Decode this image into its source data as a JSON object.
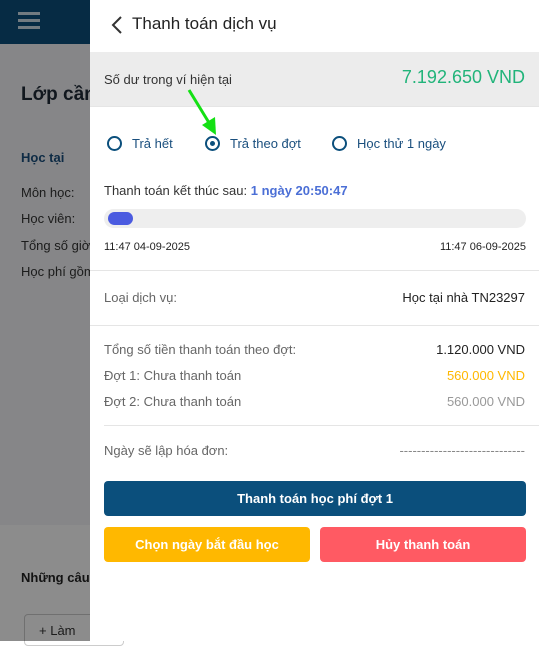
{
  "background": {
    "title": "Lớp cần",
    "tab": "Học tại",
    "rows": [
      "Môn học:",
      "Học viên:",
      "Tổng số giờ",
      "Học phí gồm"
    ],
    "section": "Những câu",
    "add_button": "Làm"
  },
  "panel": {
    "title": "Thanh toán dịch vụ",
    "balance_label": "Số dư trong ví hiện tại",
    "balance_value": "7.192.650 VND",
    "options": [
      {
        "label": "Trả hết",
        "checked": false
      },
      {
        "label": "Trả theo đợt",
        "checked": true
      },
      {
        "label": "Học thử 1 ngày",
        "checked": false
      }
    ],
    "countdown_label": "Thanh toán kết thúc sau:",
    "countdown_value": "1 ngày 20:50:47",
    "progress_fraction": 0.06,
    "start_time": "11:47 04-09-2025",
    "end_time": "11:47 06-09-2025",
    "service_label": "Loại dịch vụ:",
    "service_value": "Học tại nhà TN23297",
    "total_label": "Tổng số tiền thanh toán theo đợt:",
    "total_value": "1.120.000 VND",
    "phase1_label": "Đợt 1: Chưa thanh toán",
    "phase1_value": "560.000 VND",
    "phase2_label": "Đợt 2: Chưa thanh toán",
    "phase2_value": "560.000 VND",
    "invoice_label": "Ngày sẽ lập hóa đơn:",
    "invoice_value": "-----------------------------",
    "pay_button": "Thanh toán học phí đợt 1",
    "start_button": "Chọn ngày bắt đầu học",
    "cancel_button": "Hủy thanh toán"
  },
  "colors": {
    "primary": "#0b4f7c",
    "balance": "#21b47a",
    "phase1": "#ffb800",
    "phase2": "#999999",
    "countdown": "#4b6fd6",
    "start_button": "#ffb800",
    "cancel_button": "#ff5a63",
    "arrow": "#14e014"
  }
}
